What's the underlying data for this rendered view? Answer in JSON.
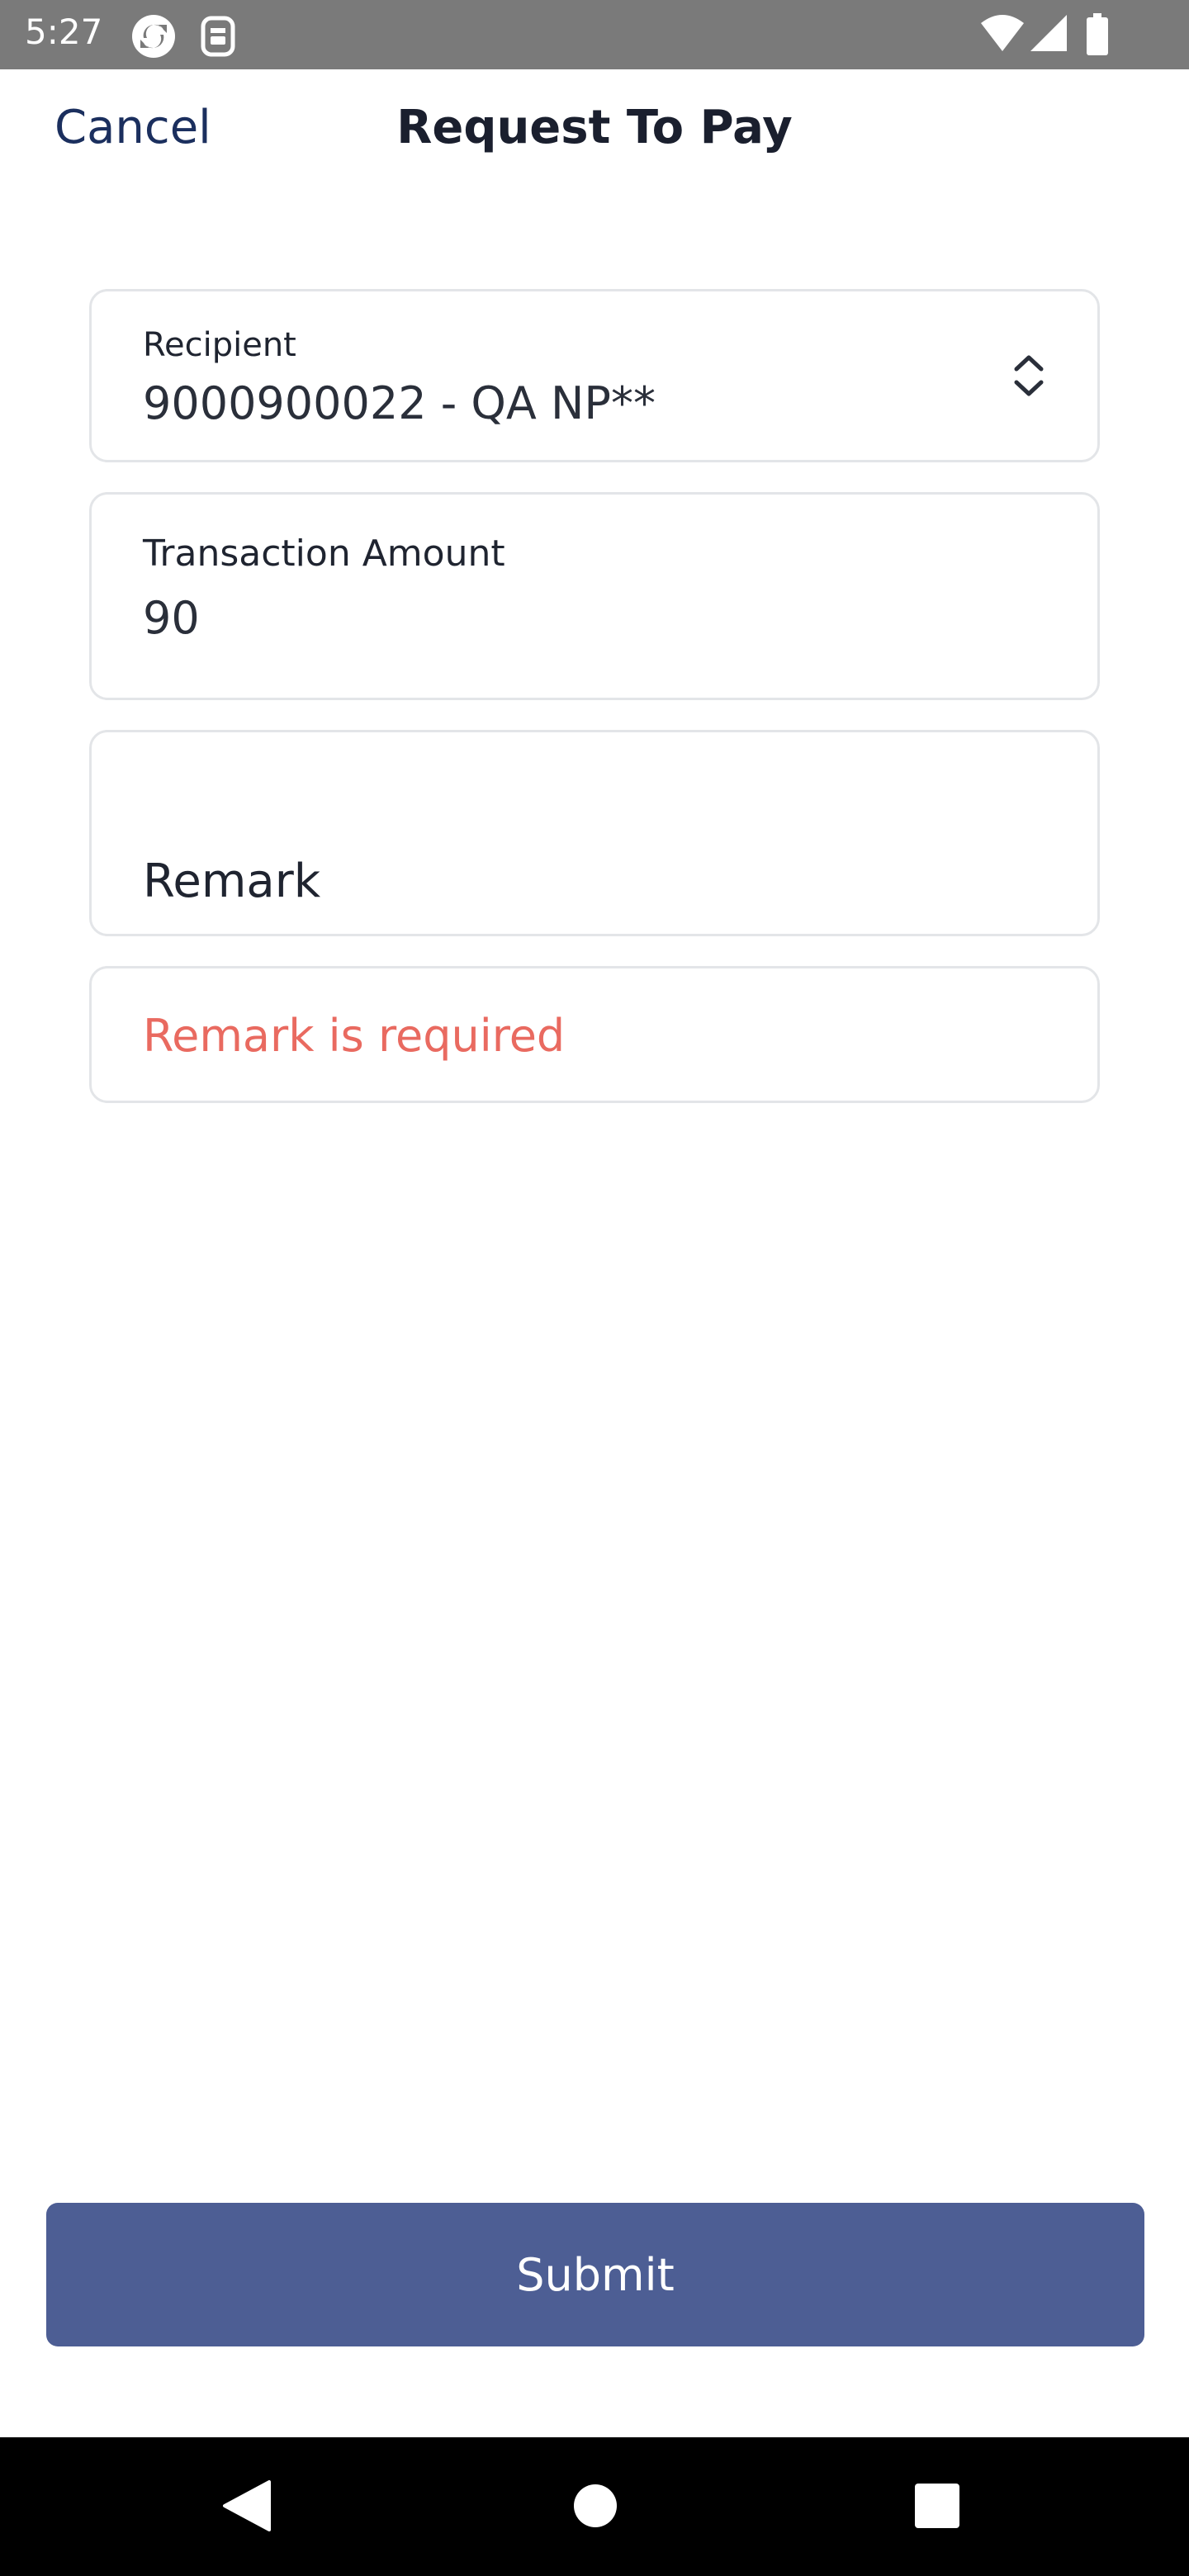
{
  "status_bar": {
    "time": "5:27",
    "icons": [
      "sync-icon",
      "sim-icon",
      "wifi-icon",
      "signal-icon",
      "battery-icon"
    ]
  },
  "header": {
    "cancel_label": "Cancel",
    "title": "Request To Pay"
  },
  "form": {
    "recipient": {
      "label": "Recipient",
      "value": "9000900022 - QA NP**",
      "icon": "sort-updown-icon"
    },
    "amount": {
      "label": "Transaction Amount",
      "value": "90"
    },
    "remark": {
      "placeholder": "Remark"
    },
    "error": {
      "message": "Remark is required"
    }
  },
  "submit": {
    "label": "Submit"
  },
  "nav_bar": {
    "icons": [
      "back-icon",
      "home-icon",
      "recents-icon"
    ]
  },
  "colors": {
    "primary": "#4d5e94",
    "header_link": "#1b2f5e",
    "error": "#e96a60",
    "border": "#e3e5e8",
    "status_bar": "#7a7a7a"
  }
}
